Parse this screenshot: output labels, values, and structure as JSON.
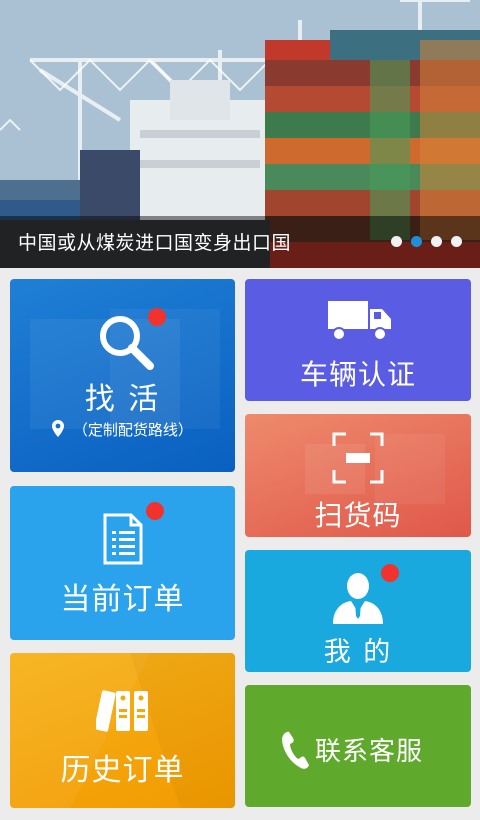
{
  "banner": {
    "caption": "中国或从煤炭进口国变身出口国",
    "slide_count": 4,
    "active_slide": 2
  },
  "tiles": {
    "find_work": {
      "label": "找 活",
      "sublabel": "（定制配货路线）",
      "icon": "search-icon",
      "badge": true,
      "color": "#1270cf"
    },
    "vehicle_cert": {
      "label": "车辆认证",
      "icon": "truck-icon",
      "color": "#5a5de3"
    },
    "scan_code": {
      "label": "扫货码",
      "icon": "scan-icon",
      "color": "#e66a55"
    },
    "current_orders": {
      "label": "当前订单",
      "icon": "document-icon",
      "badge": true,
      "color": "#2aa3ec"
    },
    "mine": {
      "label": "我 的",
      "icon": "user-icon",
      "badge": true,
      "color": "#1aa9de"
    },
    "history_orders": {
      "label": "历史订单",
      "icon": "binders-icon",
      "color": "#f5a70c"
    },
    "customer_service": {
      "label": "联系客服",
      "icon": "phone-icon",
      "color": "#5faa2c"
    }
  }
}
